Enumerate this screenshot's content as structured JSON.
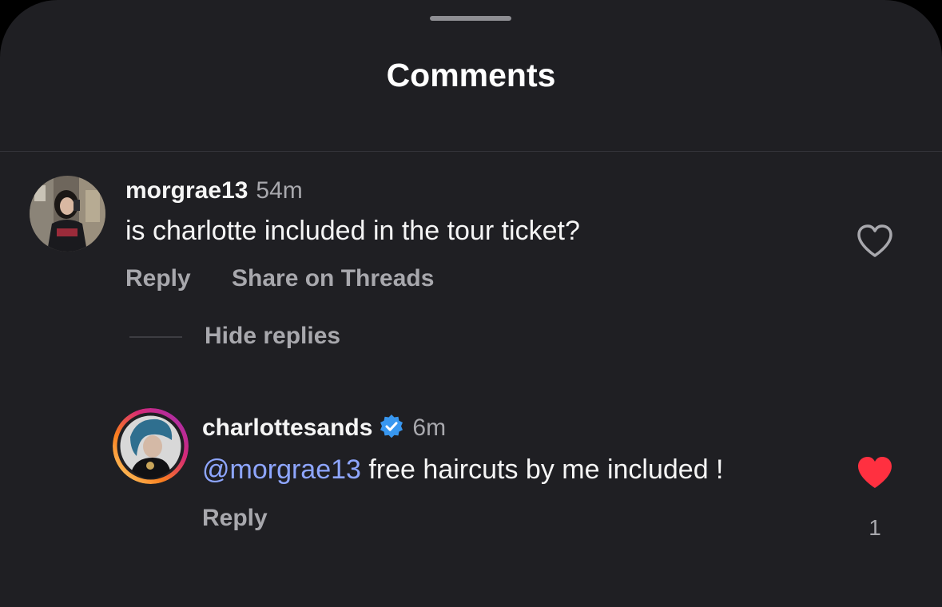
{
  "sheet": {
    "title": "Comments"
  },
  "comments": [
    {
      "username": "morgrae13",
      "time": "54m",
      "text": "is charlotte included in the tour ticket?",
      "actions": {
        "reply": "Reply",
        "share": "Share on Threads"
      },
      "liked": false,
      "hide_replies_label": "Hide replies"
    }
  ],
  "reply": {
    "username": "charlottesands",
    "verified": true,
    "time": "6m",
    "mention": "@morgrae13",
    "text": " free haircuts by me included !",
    "actions": {
      "reply": "Reply"
    },
    "liked": true,
    "like_count": "1"
  },
  "colors": {
    "background": "#1f1f23",
    "text_primary": "#f5f5f5",
    "text_secondary": "#a8a8ad",
    "mention": "#8ea6ff",
    "like_red": "#ff3040",
    "verified_blue": "#3897f0"
  },
  "icons": {
    "like_outline": "heart-outline-icon",
    "like_filled": "heart-filled-icon",
    "verified": "verified-badge-icon"
  }
}
